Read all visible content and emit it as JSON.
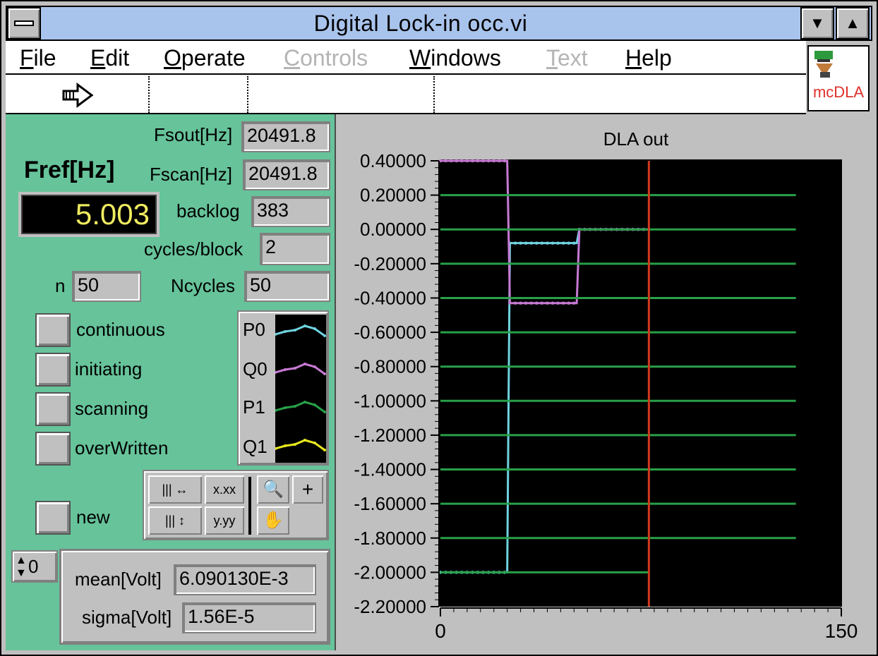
{
  "window": {
    "title": "Digital Lock-in occ.vi"
  },
  "menu": {
    "items": [
      "File",
      "Edit",
      "Operate",
      "Controls",
      "Windows",
      "Text",
      "Help"
    ]
  },
  "vi_icon": {
    "label": "mcDLA"
  },
  "controls": {
    "fsout_label": "Fsout[Hz]",
    "fsout_value": "20491.8",
    "fref_label": "Fref[Hz]",
    "fref_value": "5.003",
    "fscan_label": "Fscan[Hz]",
    "fscan_value": "20491.8",
    "backlog_label": "backlog",
    "backlog_value": "383",
    "cycles_label": "cycles/block",
    "cycles_value": "2",
    "n_label": "n",
    "n_value": "50",
    "ncycles_label": "Ncycles",
    "ncycles_value": "50"
  },
  "leds": {
    "continuous": "continuous",
    "initiating": "initiating",
    "scanning": "scanning",
    "overwritten": "overWritten",
    "new": "new"
  },
  "legend": [
    {
      "name": "P0",
      "color": "#6fd3e0"
    },
    {
      "name": "Q0",
      "color": "#c77ad4"
    },
    {
      "name": "P1",
      "color": "#28a048"
    },
    {
      "name": "Q1",
      "color": "#e8e820"
    }
  ],
  "palette": {
    "x_format": "x.xx",
    "y_format": "y.yy"
  },
  "array_index": "0",
  "stats": {
    "mean_label": "mean[Volt]",
    "mean_value": "6.090130E-3",
    "sigma_label": "sigma[Volt]",
    "sigma_value": "1.56E-5"
  },
  "chart_data": {
    "type": "line",
    "title": "DLA out",
    "xlim": [
      0,
      150
    ],
    "ylim": [
      -2.2,
      0.4
    ],
    "x_tick_labels": [
      "0",
      "150"
    ],
    "y_tick_labels": [
      "0.40000",
      "0.20000",
      "0.00000",
      "-0.20000",
      "-0.40000",
      "-0.60000",
      "-0.80000",
      "-1.00000",
      "-1.20000",
      "-1.40000",
      "-1.60000",
      "-1.80000",
      "-2.00000",
      "-2.20000"
    ],
    "cursor_x": 78,
    "background": "#000000",
    "series": [
      {
        "color": "#6fd3e0",
        "x": [
          0,
          25,
          25.5,
          26,
          51,
          52,
          78
        ],
        "y": [
          -2.0,
          -2.0,
          -1.0,
          -0.08,
          -0.08,
          0.0,
          0.0
        ]
      },
      {
        "color": "#c77ad4",
        "x": [
          0,
          25,
          26,
          51,
          52,
          78
        ],
        "y": [
          0.4,
          0.4,
          -0.43,
          -0.43,
          0.0,
          0.0
        ]
      },
      {
        "color": "#28a048",
        "x": [
          0,
          133
        ],
        "y": [
          0.2,
          0.2
        ]
      },
      {
        "color": "#28a048",
        "x": [
          0,
          133
        ],
        "y": [
          0.0,
          0.0
        ]
      },
      {
        "color": "#28a048",
        "x": [
          0,
          133
        ],
        "y": [
          -0.2,
          -0.2
        ]
      },
      {
        "color": "#28a048",
        "x": [
          0,
          133
        ],
        "y": [
          -0.4,
          -0.4
        ]
      },
      {
        "color": "#28a048",
        "x": [
          0,
          133
        ],
        "y": [
          -0.6,
          -0.6
        ]
      },
      {
        "color": "#28a048",
        "x": [
          0,
          133
        ],
        "y": [
          -0.8,
          -0.8
        ]
      },
      {
        "color": "#28a048",
        "x": [
          0,
          133
        ],
        "y": [
          -1.0,
          -1.0
        ]
      },
      {
        "color": "#28a048",
        "x": [
          0,
          133
        ],
        "y": [
          -1.2,
          -1.2
        ]
      },
      {
        "color": "#28a048",
        "x": [
          0,
          133
        ],
        "y": [
          -1.4,
          -1.4
        ]
      },
      {
        "color": "#28a048",
        "x": [
          0,
          133
        ],
        "y": [
          -1.6,
          -1.6
        ]
      },
      {
        "color": "#28a048",
        "x": [
          0,
          133
        ],
        "y": [
          -1.8,
          -1.8
        ]
      },
      {
        "color": "#28a048",
        "x": [
          0,
          78
        ],
        "y": [
          -2.0,
          -2.0
        ]
      }
    ]
  }
}
